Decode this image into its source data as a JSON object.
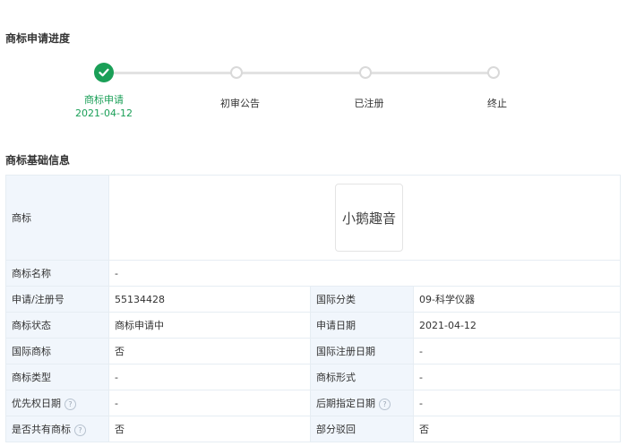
{
  "progress": {
    "title": "商标申请进度",
    "steps": [
      {
        "label": "商标申请",
        "date": "2021-04-12"
      },
      {
        "label": "初审公告"
      },
      {
        "label": "已注册"
      },
      {
        "label": "终止"
      }
    ]
  },
  "basic": {
    "title": "商标基础信息",
    "mark_label": "商标",
    "mark_image_text": "小鹅趣音",
    "name_label": "商标名称",
    "name_value": "-",
    "rows": [
      {
        "l1": "申请/注册号",
        "v1": "55134428",
        "l2": "国际分类",
        "v2": "09-科学仪器"
      },
      {
        "l1": "商标状态",
        "v1": "商标申请中",
        "l2": "申请日期",
        "v2": "2021-04-12"
      },
      {
        "l1": "国际商标",
        "v1": "否",
        "l2": "国际注册日期",
        "v2": "-"
      },
      {
        "l1": "商标类型",
        "v1": "-",
        "l2": "商标形式",
        "v2": "-"
      },
      {
        "l1": "优先权日期",
        "v1": "-",
        "l2": "后期指定日期",
        "v2": "-"
      },
      {
        "l1": "是否共有商标",
        "v1": "否",
        "l2": "部分驳回",
        "v2": "否"
      }
    ],
    "help_glyph": "?"
  },
  "colors": {
    "accent": "#1a9f57",
    "label_bg": "#f1f6fc",
    "border": "#e6edf3"
  }
}
